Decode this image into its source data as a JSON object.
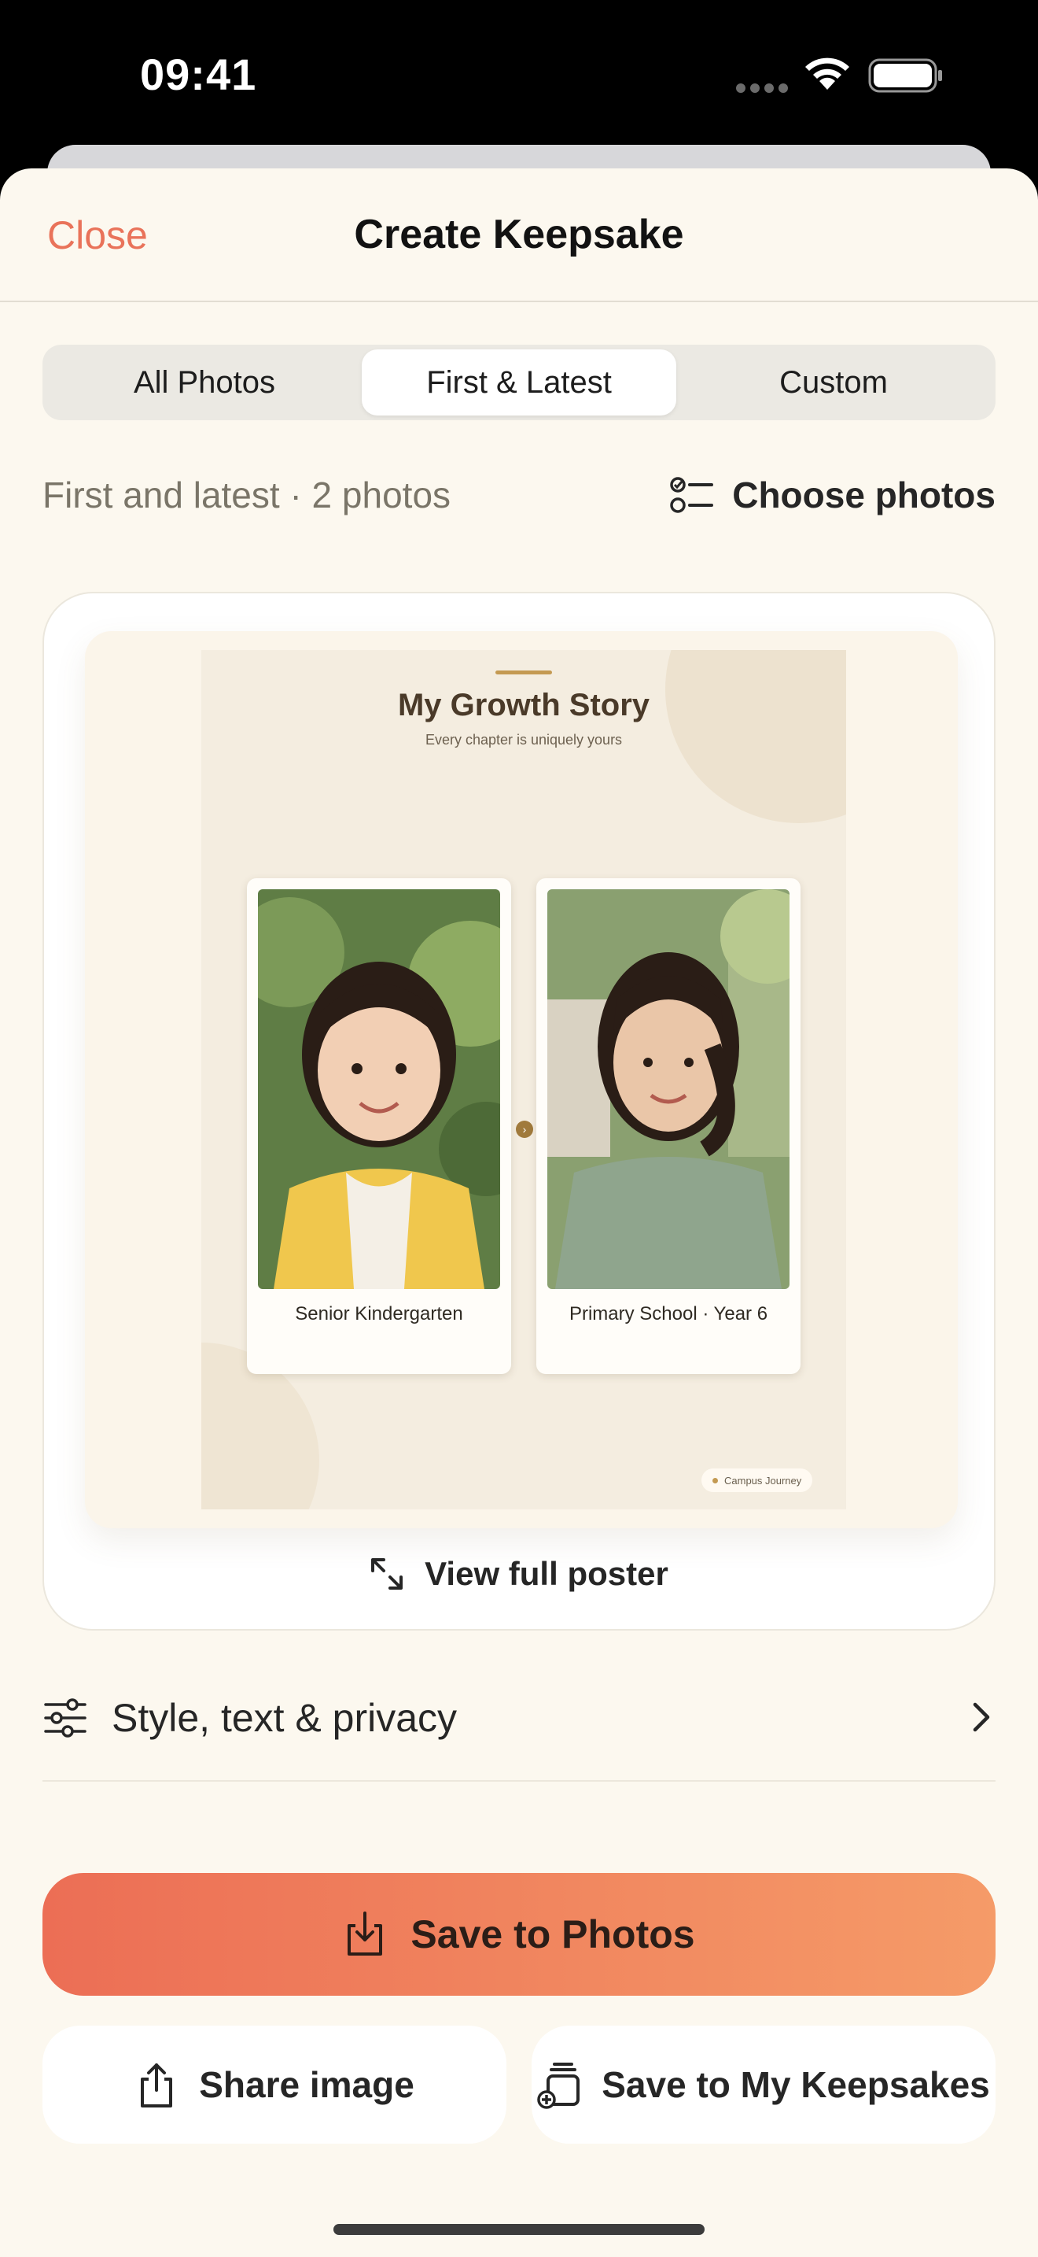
{
  "status_bar": {
    "time": "09:41"
  },
  "nav": {
    "close_label": "Close",
    "title": "Create Keepsake"
  },
  "segments": [
    {
      "label": "All Photos",
      "active": false
    },
    {
      "label": "First & Latest",
      "active": true
    },
    {
      "label": "Custom",
      "active": false
    }
  ],
  "selection": {
    "summary": "First and latest · 2 photos",
    "choose_label": "Choose photos"
  },
  "poster": {
    "title": "My Growth Story",
    "subtitle": "Every chapter is uniquely yours",
    "photos": [
      {
        "caption": "Senior Kindergarten"
      },
      {
        "caption": "Primary School · Year 6"
      }
    ],
    "badge": "Campus Journey",
    "view_full_label": "View full poster"
  },
  "style_row": {
    "label": "Style, text & privacy"
  },
  "actions": {
    "save_photos": "Save to Photos",
    "share_image": "Share image",
    "save_keepsakes": "Save to My Keepsakes"
  },
  "colors": {
    "accent": "#e9735a",
    "sheet_bg": "#fcf8ef",
    "gradient_start": "#ec6e55",
    "gradient_end": "#f59b68",
    "poster_bg": "#f4ede0"
  }
}
